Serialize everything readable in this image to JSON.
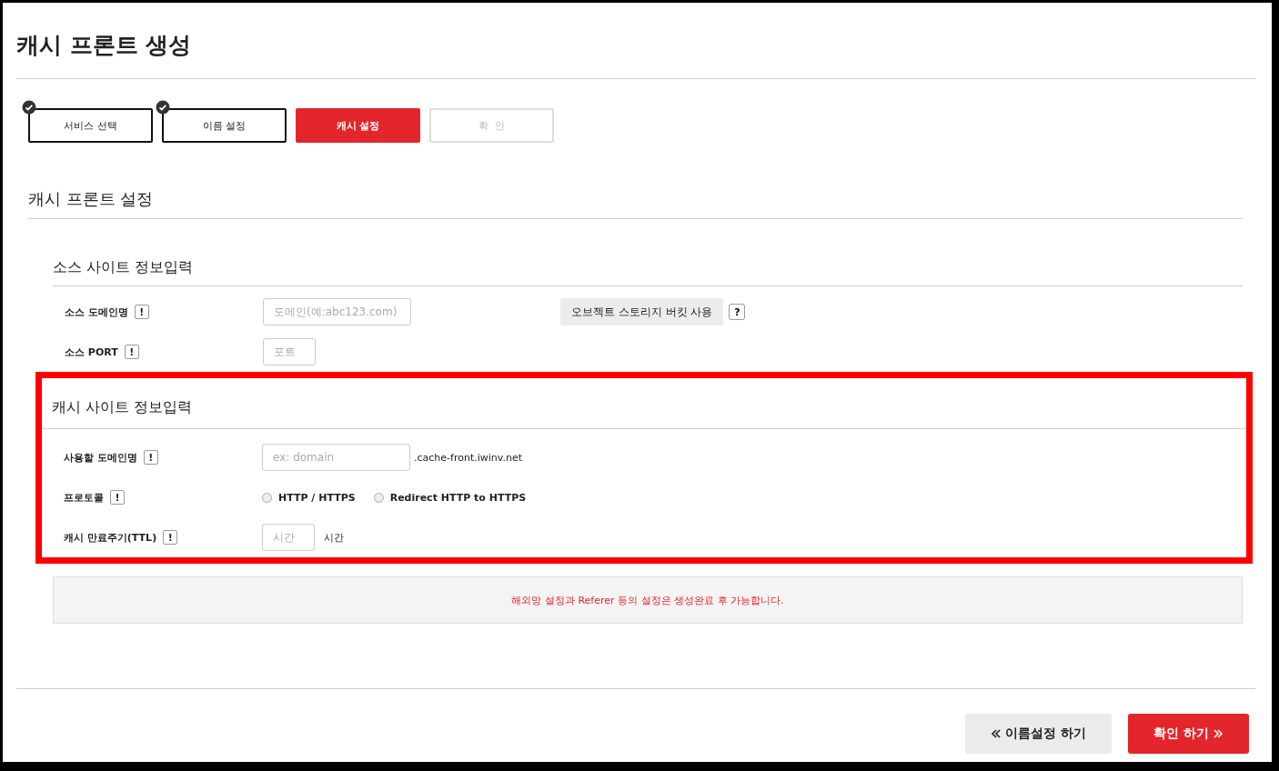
{
  "page_title": "캐시 프론트 생성",
  "steps": [
    {
      "label": "서비스 선택",
      "completed": true,
      "selected": false
    },
    {
      "label": "이름 설정",
      "completed": true,
      "selected": false
    },
    {
      "label": "캐시 설정",
      "completed": false,
      "selected": true
    },
    {
      "label": "확  인",
      "completed": false,
      "selected": false
    }
  ],
  "section_title": "캐시 프론트 설정",
  "groups": [
    {
      "title": "소스 사이트 정보입력",
      "highlighted": false,
      "rows": [
        {
          "kind": "wide_input",
          "label": "소스 도메인명",
          "placeholder": "도메인(예:abc123.com)",
          "button": "오브젝트 스토리지 버킷 사용",
          "help": "?"
        },
        {
          "kind": "narrow_input",
          "label": "소스 PORT",
          "placeholder": "포트"
        }
      ]
    },
    {
      "title": "캐시 사이트 정보입력",
      "highlighted": true,
      "rows": [
        {
          "kind": "wide_input",
          "label": "사용할 도메인명",
          "placeholder": "ex: domain",
          "suffix": ".cache-front.iwinv.net"
        },
        {
          "kind": "radio",
          "label": "프로토콜",
          "options": [
            {
              "label": "HTTP / HTTPS",
              "selected": false
            },
            {
              "label": "Redirect HTTP to HTTPS",
              "selected": false
            }
          ]
        },
        {
          "kind": "narrow_input",
          "label": "캐시 만료주기(TTL)",
          "placeholder": "시간",
          "suffix": "시간"
        }
      ]
    }
  ],
  "info_mark": "!",
  "notice": "해외망 설정과 Referer 등의 설정은 생성완료 후 가능합니다.",
  "buttons": [
    {
      "label": "이름설정 하기",
      "kind": "prev"
    },
    {
      "label": "확인 하기",
      "kind": "next"
    }
  ]
}
